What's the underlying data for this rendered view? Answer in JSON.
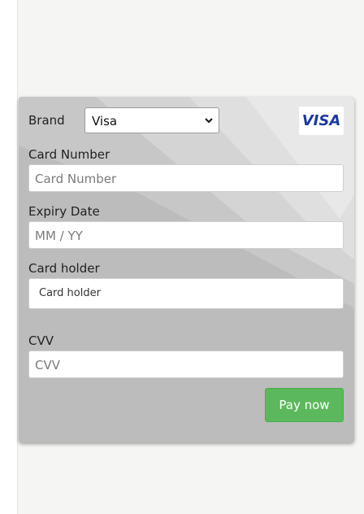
{
  "form": {
    "brand_label": "Brand",
    "brand_selected": "Visa",
    "brand_logo_text": "VISA",
    "card_number_label": "Card Number",
    "card_number_placeholder": "Card Number",
    "expiry_label": "Expiry Date",
    "expiry_placeholder": "MM / YY",
    "holder_label": "Card holder",
    "holder_placeholder": "Card holder",
    "cvv_label": "CVV",
    "cvv_placeholder": "CVV",
    "pay_button": "Pay now"
  },
  "colors": {
    "card_background": "#bdbdbd",
    "pay_button": "#5cb85c",
    "visa_blue": "#1a3aa0"
  }
}
